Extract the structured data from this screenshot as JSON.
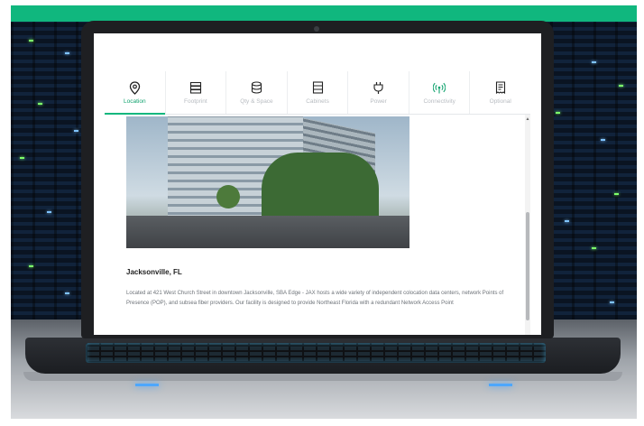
{
  "colors": {
    "accent": "#10b77e",
    "inactive_tab": "#b8bcc1"
  },
  "tabs": [
    {
      "label": "Location",
      "icon": "map-pin-icon",
      "active": true
    },
    {
      "label": "Footprint",
      "icon": "server-stack-icon",
      "active": false
    },
    {
      "label": "Qty & Space",
      "icon": "database-icon",
      "active": false
    },
    {
      "label": "Cabinets",
      "icon": "cabinet-icon",
      "active": false
    },
    {
      "label": "Power",
      "icon": "power-plug-icon",
      "active": false
    },
    {
      "label": "Connectivity",
      "icon": "signal-icon",
      "active": false
    },
    {
      "label": "Optional",
      "icon": "receipt-icon",
      "active": false
    }
  ],
  "location": {
    "city": "Jacksonville, FL",
    "description": "Located at 421 West Church Street in downtown Jacksonville, SBA Edge - JAX hosts a wide variety of independent colocation data centers, network Points of Presence (POP), and subsea fiber providers. Our facility is designed to provide Northeast Florida with a redundant Network Access Point"
  }
}
